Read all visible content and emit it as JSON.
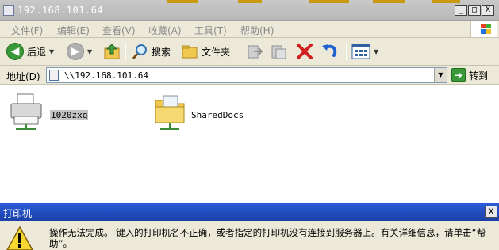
{
  "window": {
    "title": "192.168.101.64",
    "controls": {
      "minimize": "_",
      "maximize": "□",
      "close": "X"
    }
  },
  "menu": [
    {
      "label": "文件(F)"
    },
    {
      "label": "编辑(E)"
    },
    {
      "label": "查看(V)"
    },
    {
      "label": "收藏(A)"
    },
    {
      "label": "工具(T)"
    },
    {
      "label": "帮助(H)"
    }
  ],
  "toolbar": {
    "back_label": "后退",
    "search_label": "搜索",
    "folders_label": "文件夹"
  },
  "address": {
    "label": "地址(D)",
    "value": "\\\\192.168.101.64",
    "go_label": "转到"
  },
  "items": [
    {
      "name": "1020zxq",
      "icon": "printer-icon",
      "selected": true
    },
    {
      "name": "SharedDocs",
      "icon": "shared-folder-icon",
      "selected": false
    }
  ],
  "dialog": {
    "title": "打印机",
    "close": "X",
    "message": "操作无法完成。 键入的打印机名不正确，或者指定的打印机没有连接到服务器上。有关详细信息，请单击“帮助”。"
  },
  "colors": {
    "dialog_title_bg": "#1f4ec0",
    "go_green": "#3a9a3a",
    "delete_red": "#d02020",
    "undo_blue": "#2060d0"
  }
}
